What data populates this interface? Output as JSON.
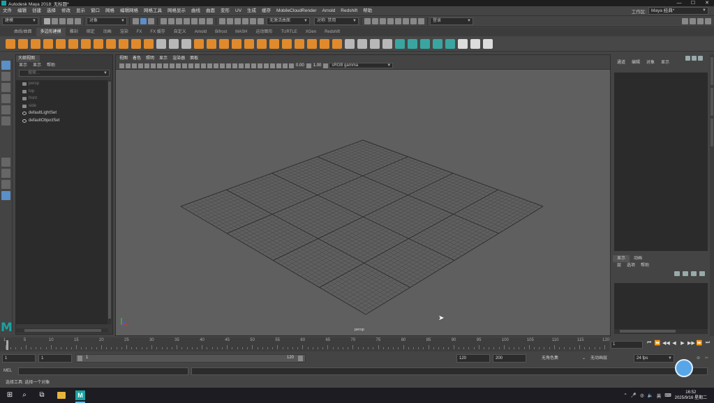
{
  "title": "Autodesk Maya 2018: 无标题*",
  "window_controls": [
    "—",
    "☐",
    "✕"
  ],
  "menubar": [
    "文件",
    "编辑",
    "创建",
    "选择",
    "修改",
    "显示",
    "窗口",
    "网格",
    "编辑网格",
    "网格工具",
    "网格显示",
    "曲线",
    "曲面",
    "变形",
    "UV",
    "生成",
    "缓存",
    "MobileCloudRender",
    "Arnold",
    "Redshift",
    "帮助"
  ],
  "workspace": {
    "label": "工作区:",
    "value": "Maya 经典*"
  },
  "statusline": {
    "mode": "建模",
    "object_mode": "对象",
    "symmetry": "无激活曲面",
    "symmetry2": "对称: 禁用",
    "login": "登录"
  },
  "shelf_tabs": [
    "曲线/曲面",
    "多边形建模",
    "雕刻",
    "绑定",
    "动画",
    "渲染",
    "FX",
    "FX 缓存",
    "自定义",
    "Arnold",
    "Bifrost",
    "MASH",
    "运动图形",
    "TURTLE",
    "XGen",
    "Redshift"
  ],
  "shelf_active_tab": 1,
  "outliner": {
    "title": "大纲视图",
    "menu": [
      "显示",
      "显示",
      "帮助"
    ],
    "search_placeholder": "搜索...",
    "items": [
      {
        "label": "persp",
        "dim": true
      },
      {
        "label": "top",
        "dim": true
      },
      {
        "label": "front",
        "dim": true
      },
      {
        "label": "side",
        "dim": true
      },
      {
        "label": "defaultLightSet",
        "dim": false
      },
      {
        "label": "defaultObjectSet",
        "dim": false
      }
    ]
  },
  "viewport": {
    "menu": [
      "视图",
      "着色",
      "照明",
      "显示",
      "渲染器",
      "面板"
    ],
    "exposure": "0.00",
    "gamma": "1.00",
    "color_space": "sRGB gamma",
    "camera": "persp"
  },
  "channel_box": {
    "tabs": [
      "通道",
      "编辑",
      "对象",
      "显示"
    ]
  },
  "layer_editor": {
    "tabs": [
      "显示",
      "动画"
    ],
    "menu": [
      "层",
      "选项",
      "帮助"
    ]
  },
  "timeslider": {
    "ticks": [
      1,
      5,
      10,
      15,
      20,
      25,
      30,
      35,
      40,
      45,
      50,
      55,
      60,
      65,
      70,
      75,
      80,
      85,
      90,
      95,
      100,
      105,
      110,
      115,
      120
    ],
    "current_frame": "1",
    "playback": [
      "⏮",
      "⏪",
      "◀◀",
      "◀",
      "▶",
      "▶▶",
      "⏩",
      "⏭"
    ]
  },
  "range": {
    "start": "1",
    "playback_start": "1",
    "range_start_label": "1",
    "range_end_label": "120",
    "playback_end": "120",
    "end": "200",
    "char_set": "无角色集",
    "anim_layer": "无动画层",
    "fps": "24 fps"
  },
  "cmdline": {
    "lang": "MEL"
  },
  "helpline": "选择工具: 选择一个对象",
  "taskbar": {
    "ime": "英",
    "time": "16:52",
    "date": "2025/9/16 星期二"
  }
}
